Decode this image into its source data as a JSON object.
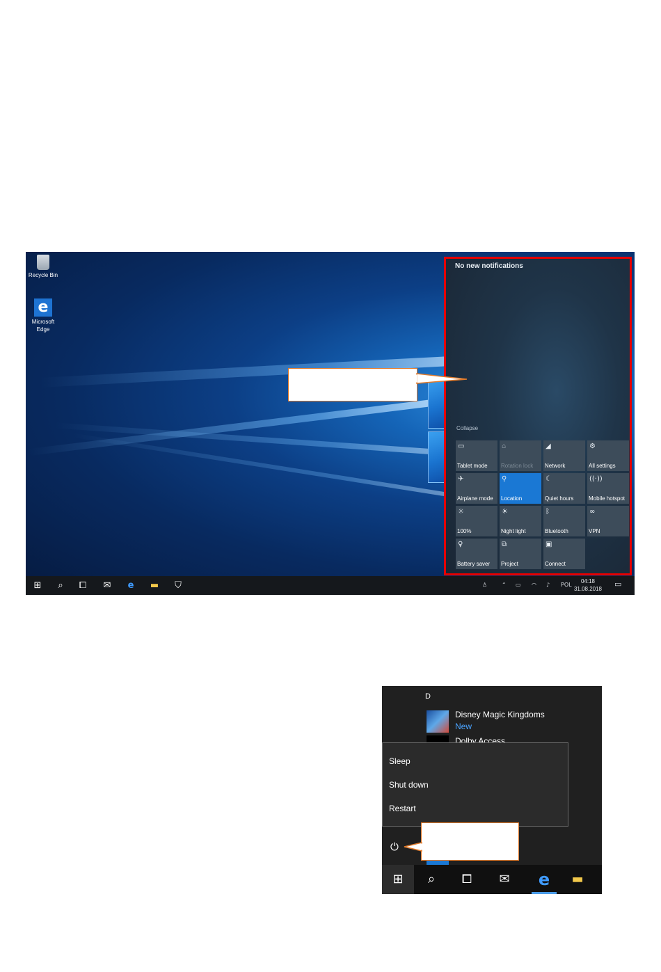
{
  "desktop": {
    "icons": [
      {
        "name": "recycle-bin",
        "label": "Recycle Bin"
      },
      {
        "name": "microsoft-edge",
        "label_line1": "Microsoft",
        "label_line2": "Edge"
      }
    ]
  },
  "action_center": {
    "title": "No new notifications",
    "collapse": "Collapse",
    "tiles": [
      {
        "label": "Tablet mode",
        "icon": "tablet-icon",
        "glyph": "▭",
        "state": "off"
      },
      {
        "label": "Rotation lock",
        "icon": "rotation-lock-icon",
        "glyph": "⌂",
        "state": "disabled"
      },
      {
        "label": "Network",
        "icon": "network-icon",
        "glyph": "◢",
        "state": "off"
      },
      {
        "label": "All settings",
        "icon": "gear-icon",
        "glyph": "⚙",
        "state": "off"
      },
      {
        "label": "Airplane mode",
        "icon": "airplane-icon",
        "glyph": "✈",
        "state": "off"
      },
      {
        "label": "Location",
        "icon": "location-icon",
        "glyph": "⚲",
        "state": "on"
      },
      {
        "label": "Quiet hours",
        "icon": "moon-icon",
        "glyph": "☾",
        "state": "off"
      },
      {
        "label": "Mobile hotspot",
        "icon": "hotspot-icon",
        "glyph": "((·))",
        "state": "off"
      },
      {
        "label": "100%",
        "icon": "brightness-icon",
        "glyph": "☼",
        "state": "off"
      },
      {
        "label": "Night light",
        "icon": "night-light-icon",
        "glyph": "☀",
        "state": "off"
      },
      {
        "label": "Bluetooth",
        "icon": "bluetooth-icon",
        "glyph": "ᛒ",
        "state": "off"
      },
      {
        "label": "VPN",
        "icon": "vpn-icon",
        "glyph": "∞",
        "state": "off"
      },
      {
        "label": "Battery saver",
        "icon": "battery-saver-icon",
        "glyph": "♀",
        "state": "off"
      },
      {
        "label": "Project",
        "icon": "project-icon",
        "glyph": "⧉",
        "state": "off"
      },
      {
        "label": "Connect",
        "icon": "connect-icon",
        "glyph": "▣",
        "state": "off"
      }
    ]
  },
  "taskbar1": {
    "language": "POL",
    "time": "04:18",
    "date": "31.08.2018"
  },
  "start_menu": {
    "section_letter": "D",
    "app_name": "Disney Magic Kingdoms",
    "app_sub": "New",
    "next_app_partial": "Dolby Access",
    "power_menu": [
      "Sleep",
      "Shut down",
      "Restart"
    ]
  },
  "colors": {
    "action_center_border": "#e60000",
    "callout_border": "#e07a2b",
    "accent": "#1a78d4"
  }
}
